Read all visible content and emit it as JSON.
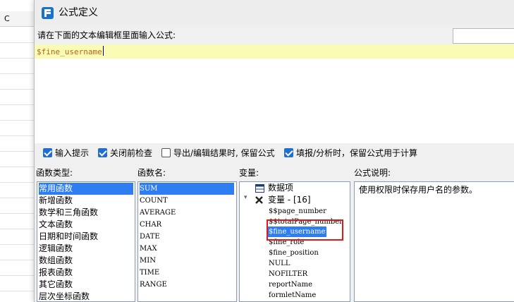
{
  "background_sheet": {
    "column_label": "C"
  },
  "dialog": {
    "title": "公式定义",
    "prompt": "请在下面的文本编辑框里面输入公式:",
    "formula": "$fine_username"
  },
  "options": [
    {
      "label": "输入提示",
      "checked": true
    },
    {
      "label": "关闭前检查",
      "checked": true
    },
    {
      "label": "导出/编辑结果时, 保留公式",
      "checked": false
    },
    {
      "label": "填报/分析时，保留公式用于计算",
      "checked": true
    }
  ],
  "panels": {
    "function_type": {
      "header": "函数类型:",
      "items": [
        "常用函数",
        "新增函数",
        "数学和三角函数",
        "文本函数",
        "日期和时间函数",
        "逻辑函数",
        "数组函数",
        "报表函数",
        "其它函数",
        "层次坐标函数"
      ],
      "selected": 0
    },
    "function_name": {
      "header": "函数名:",
      "items": [
        "SUM",
        "COUNT",
        "AVERAGE",
        "CHAR",
        "DATE",
        "MAX",
        "MIN",
        "TIME",
        "RANGE"
      ],
      "selected": 0
    },
    "variables": {
      "header": "变量:",
      "data_item": "数据项",
      "group_label": "变量 - [16]",
      "items": [
        "$$page_number",
        "$$totalPage_number",
        "$fine_username",
        "$fine_role",
        "$fine_position",
        "NULL",
        "NOFILTER",
        "reportName",
        "formletName"
      ],
      "selected": 2
    },
    "description": {
      "header": "公式说明:",
      "text": "使用权限时保存用户名的参数。"
    }
  },
  "colors": {
    "selection": "#2e7ef1",
    "checkbox": "#1f6fd1",
    "highlight_box": "#e01818",
    "editor_line": "#fafbb4"
  }
}
